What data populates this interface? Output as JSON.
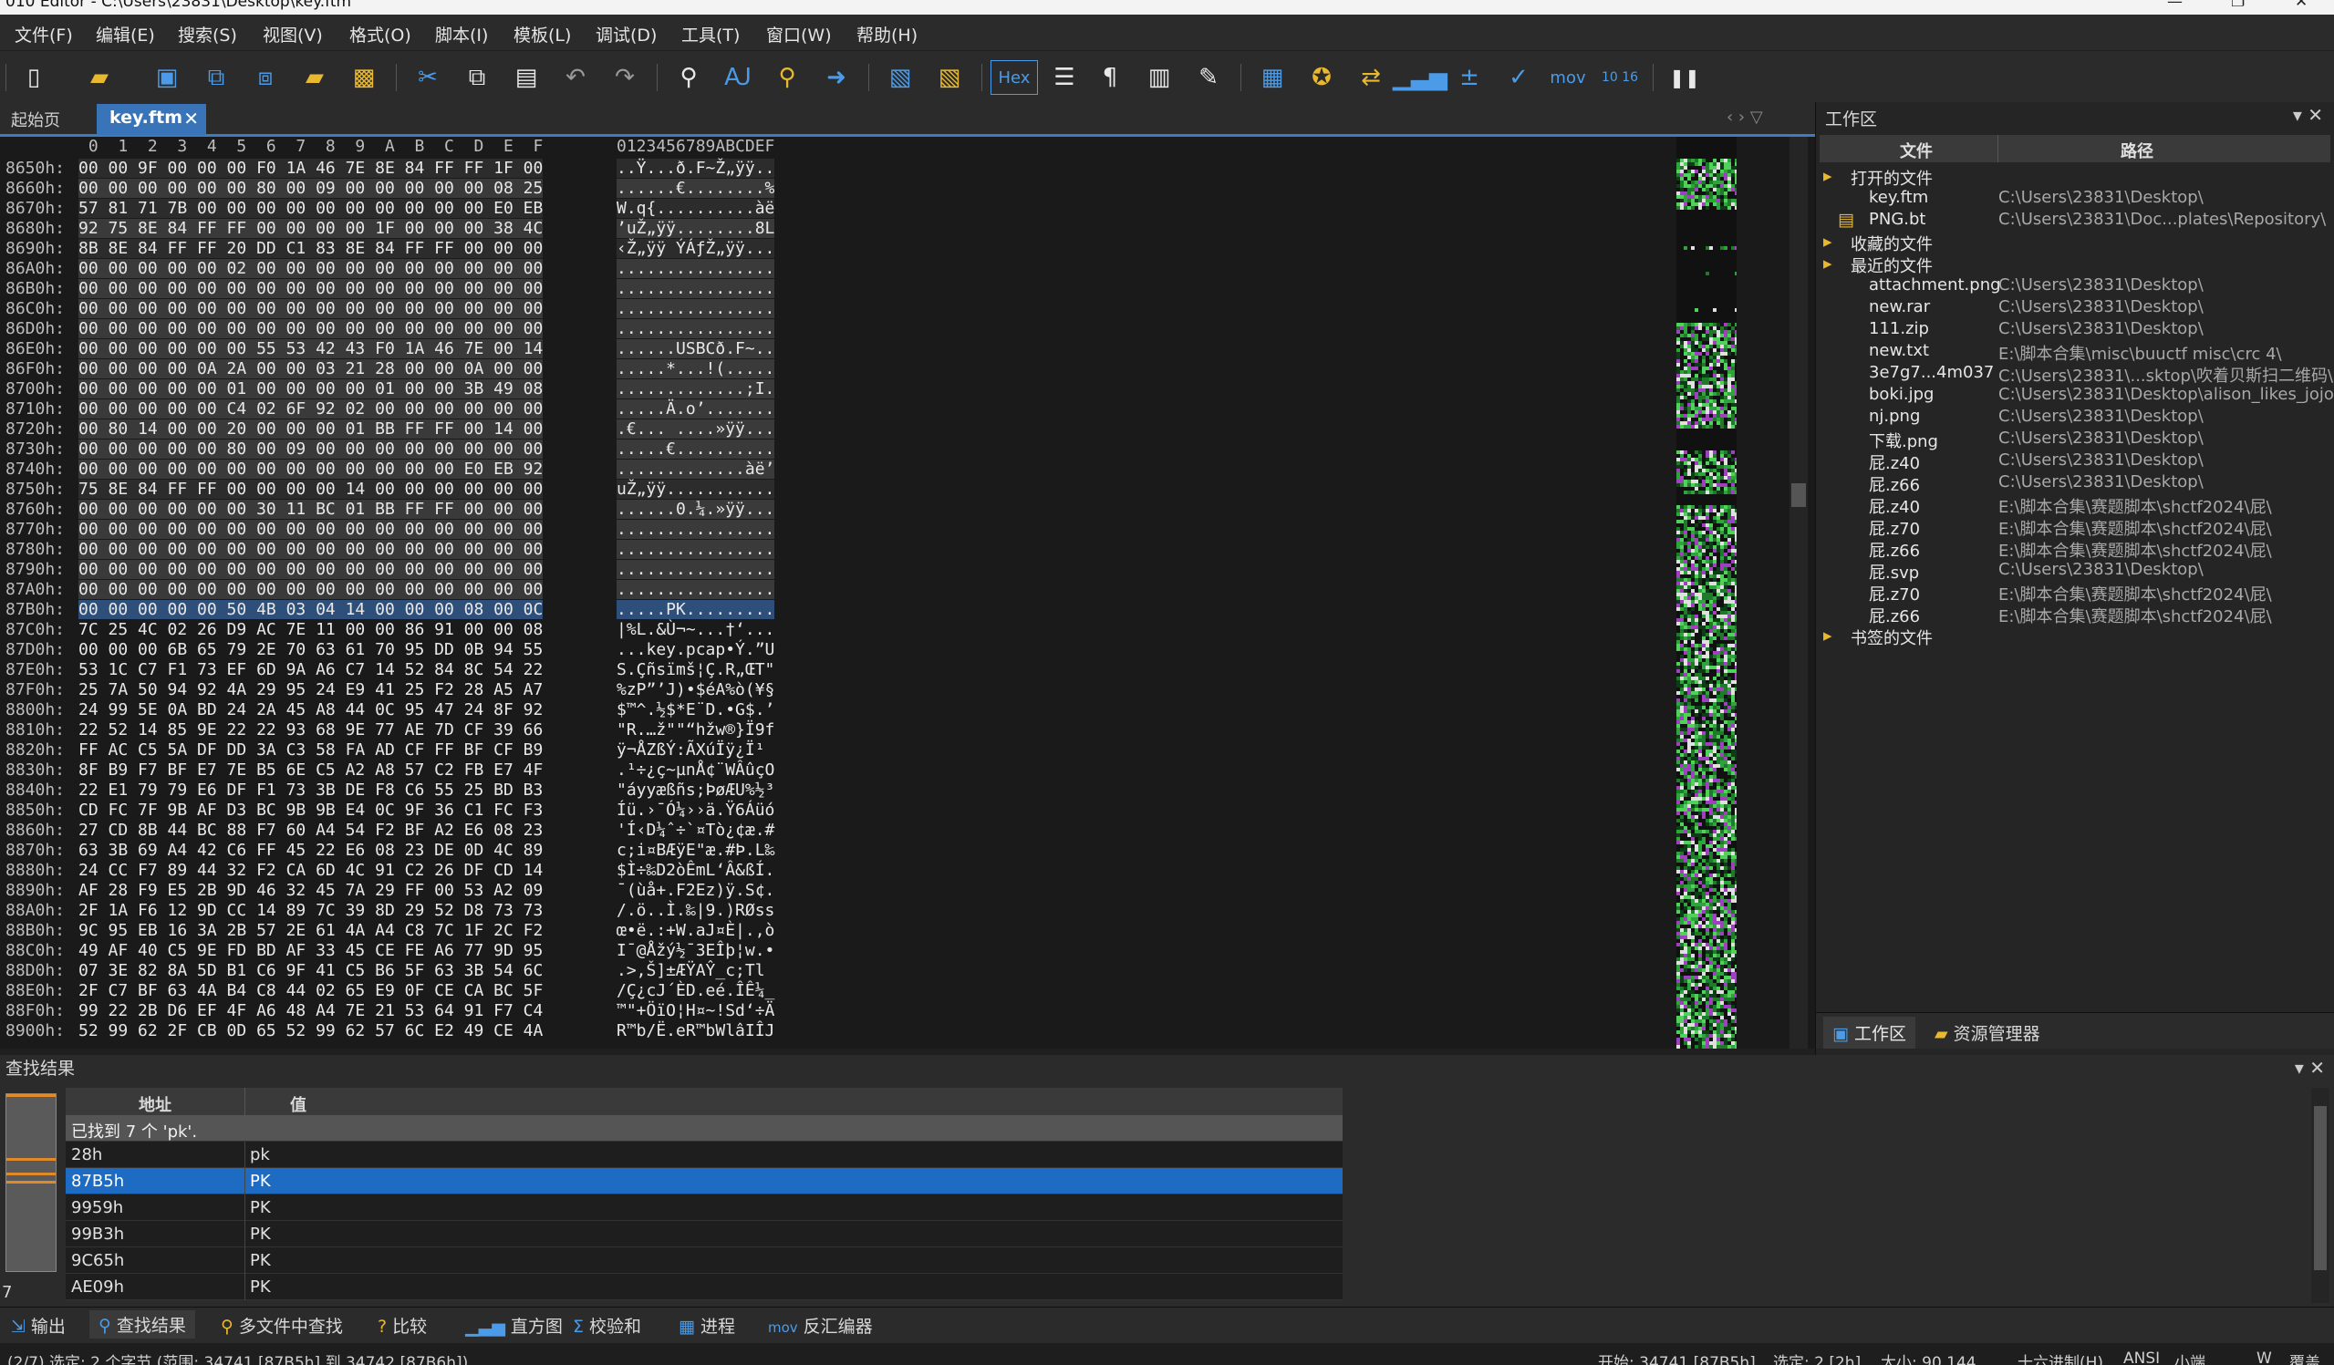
{
  "window": {
    "title": "010 Editor - C:\\Users\\23831\\Desktop\\key.ftm",
    "controls": [
      "—",
      "❐",
      "✕"
    ]
  },
  "menu": [
    "文件(F)",
    "编辑(E)",
    "搜索(S)",
    "视图(V)",
    "格式(O)",
    "脚本(I)",
    "模板(L)",
    "调试(D)",
    "工具(T)",
    "窗口(W)",
    "帮助(H)"
  ],
  "toolbar": {
    "hex_label": "Hex",
    "mov_label": "mov",
    "calc_label": "10 16"
  },
  "tabs": {
    "start": "起始页",
    "active": "key.ftm",
    "close": "✕",
    "nav": "‹  ›  ▽"
  },
  "hex": {
    "header_cols": " 0  1  2  3  4  5  6  7  8  9  A  B  C  D  E  F",
    "header_ascii": "0123456789ABCDEF",
    "rows": [
      {
        "addr": "8650h:",
        "bytes": "00 00 9F 00 00 00 F0 1A 46 7E 8E 84 FF FF 1F 00",
        "ascii": "..Ÿ...ð.F~Ž„ÿÿ..",
        "style": "alt"
      },
      {
        "addr": "8660h:",
        "bytes": "00 00 00 00 00 00 80 00 09 00 00 00 00 00 08 25",
        "ascii": "......€........%",
        "style": "zero"
      },
      {
        "addr": "8670h:",
        "bytes": "57 81 71 7B 00 00 00 00 00 00 00 00 00 00 E0 EB",
        "ascii": "W.q{..........àë",
        "style": "alt"
      },
      {
        "addr": "8680h:",
        "bytes": "92 75 8E 84 FF FF 00 00 00 00 1F 00 00 00 38 4C",
        "ascii": "’uŽ„ÿÿ........8L",
        "style": "zero"
      },
      {
        "addr": "8690h:",
        "bytes": "8B 8E 84 FF FF 20 DD C1 83 8E 84 FF FF 00 00 00",
        "ascii": "‹Ž„ÿÿ ÝÁƒŽ„ÿÿ...",
        "style": "alt"
      },
      {
        "addr": "86A0h:",
        "bytes": "00 00 00 00 00 02 00 00 00 00 00 00 00 00 00 00",
        "ascii": "................",
        "style": "zero"
      },
      {
        "addr": "86B0h:",
        "bytes": "00 00 00 00 00 00 00 00 00 00 00 00 00 00 00 00",
        "ascii": "................",
        "style": "zero"
      },
      {
        "addr": "86C0h:",
        "bytes": "00 00 00 00 00 00 00 00 00 00 00 00 00 00 00 00",
        "ascii": "................",
        "style": "zero"
      },
      {
        "addr": "86D0h:",
        "bytes": "00 00 00 00 00 00 00 00 00 00 00 00 00 00 00 00",
        "ascii": "................",
        "style": "zero"
      },
      {
        "addr": "86E0h:",
        "bytes": "00 00 00 00 00 00 55 53 42 43 F0 1A 46 7E 00 14",
        "ascii": "......USBCð.F~..",
        "style": "zero"
      },
      {
        "addr": "86F0h:",
        "bytes": "00 00 00 00 0A 2A 00 00 03 21 28 00 00 0A 00 00",
        "ascii": ".....*...!(.....",
        "style": "zero"
      },
      {
        "addr": "8700h:",
        "bytes": "00 00 00 00 00 01 00 00 00 00 01 00 00 3B 49 08",
        "ascii": ".............;I.",
        "style": "zero"
      },
      {
        "addr": "8710h:",
        "bytes": "00 00 00 00 00 C4 02 6F 92 02 00 00 00 00 00 00",
        "ascii": ".....Ä.o’.......",
        "style": "zero"
      },
      {
        "addr": "8720h:",
        "bytes": "00 80 14 00 00 20 00 00 00 01 BB FF FF 00 14 00",
        "ascii": ".€... ....»ÿÿ...",
        "style": "zero"
      },
      {
        "addr": "8730h:",
        "bytes": "00 00 00 00 00 80 00 09 00 00 00 00 00 00 00 00",
        "ascii": ".....€..........",
        "style": "zero"
      },
      {
        "addr": "8740h:",
        "bytes": "00 00 00 00 00 00 00 00 00 00 00 00 00 E0 EB 92",
        "ascii": ".............àë’",
        "style": "zero"
      },
      {
        "addr": "8750h:",
        "bytes": "75 8E 84 FF FF 00 00 00 00 14 00 00 00 00 00 00",
        "ascii": "uŽ„ÿÿ...........",
        "style": "alt"
      },
      {
        "addr": "8760h:",
        "bytes": "00 00 00 00 00 00 30 11 BC 01 BB FF FF 00 00 00",
        "ascii": "......0.¼.»ÿÿ...",
        "style": "zero"
      },
      {
        "addr": "8770h:",
        "bytes": "00 00 00 00 00 00 00 00 00 00 00 00 00 00 00 00",
        "ascii": "................",
        "style": "zero"
      },
      {
        "addr": "8780h:",
        "bytes": "00 00 00 00 00 00 00 00 00 00 00 00 00 00 00 00",
        "ascii": "................",
        "style": "zero"
      },
      {
        "addr": "8790h:",
        "bytes": "00 00 00 00 00 00 00 00 00 00 00 00 00 00 00 00",
        "ascii": "................",
        "style": "zero"
      },
      {
        "addr": "87A0h:",
        "bytes": "00 00 00 00 00 00 00 00 00 00 00 00 00 00 00 00",
        "ascii": "................",
        "style": "zero"
      },
      {
        "addr": "87B0h:",
        "bytes": "00 00 00 00 00 50 4B 03 04 14 00 00 00 08 00 0C",
        "ascii": ".....PK.........",
        "style": "sel"
      },
      {
        "addr": "87C0h:",
        "bytes": "7C 25 4C 02 26 D9 AC 7E 11 00 00 86 91 00 00 08",
        "ascii": "|%L.&Ù¬~...†‘...",
        "style": ""
      },
      {
        "addr": "87D0h:",
        "bytes": "00 00 00 6B 65 79 2E 70 63 61 70 95 DD 0B 94 55",
        "ascii": "...key.pcap•Ý.”U",
        "style": ""
      },
      {
        "addr": "87E0h:",
        "bytes": "53 1C C7 F1 73 EF 6D 9A A6 C7 14 52 84 8C 54 22",
        "ascii": "S.Çñsïmš¦Ç.R„ŒT\"",
        "style": ""
      },
      {
        "addr": "87F0h:",
        "bytes": "25 7A 50 94 92 4A 29 95 24 E9 41 25 F2 28 A5 A7",
        "ascii": "%zP”’J)•$éA%ò(¥§",
        "style": ""
      },
      {
        "addr": "8800h:",
        "bytes": "24 99 5E 0A BD 24 2A 45 A8 44 0C 95 47 24 8F 92",
        "ascii": "$™^.½$*E¨D.•G$.’",
        "style": ""
      },
      {
        "addr": "8810h:",
        "bytes": "22 52 14 85 9E 22 22 93 68 9E 77 AE 7D CF 39 66",
        "ascii": "\"R.…ž\"\"“hžw®}Ï9f",
        "style": ""
      },
      {
        "addr": "8820h:",
        "bytes": "FF AC C5 5A DF DD 3A C3 58 FA AD CF FF BF CF B9",
        "ascii": "ÿ¬ÅZßÝ:ÃXú­Ïÿ¿Ï¹",
        "style": ""
      },
      {
        "addr": "8830h:",
        "bytes": "8F B9 F7 BF E7 7E B5 6E C5 A2 A8 57 C2 FB E7 4F",
        "ascii": ".¹÷¿ç~µnÅ¢¨WÂûçO",
        "style": ""
      },
      {
        "addr": "8840h:",
        "bytes": "22 E1 79 79 E6 DF F1 73 3B DE F8 C6 55 25 BD B3",
        "ascii": "\"áyyæßñs;ÞøÆU%½³",
        "style": ""
      },
      {
        "addr": "8850h:",
        "bytes": "CD FC 7F 9B AF D3 BC 9B 9B E4 0C 9F 36 C1 FC F3",
        "ascii": "Íü.›¯Ó¼››ä.Ÿ6Áüó",
        "style": ""
      },
      {
        "addr": "8860h:",
        "bytes": "27 CD 8B 44 BC 88 F7 60 A4 54 F2 BF A2 E6 08 23",
        "ascii": "'Í‹D¼ˆ÷`¤Tò¿¢æ.#",
        "style": ""
      },
      {
        "addr": "8870h:",
        "bytes": "63 3B 69 A4 42 C6 FF 45 22 E6 08 23 DE 0D 4C 89",
        "ascii": "c;i¤BÆÿE\"æ.#Þ.L‰",
        "style": ""
      },
      {
        "addr": "8880h:",
        "bytes": "24 CC F7 89 44 32 F2 CA 6D 4C 91 C2 26 DF CD 14",
        "ascii": "$Ì÷‰D2òÊmL‘Â&ßÍ.",
        "style": ""
      },
      {
        "addr": "8890h:",
        "bytes": "AF 28 F9 E5 2B 9D 46 32 45 7A 29 FF 00 53 A2 09",
        "ascii": "¯(ùå+.F2Ez)ÿ.S¢.",
        "style": ""
      },
      {
        "addr": "88A0h:",
        "bytes": "2F 1A F6 12 9D CC 14 89 7C 39 8D 29 52 D8 73 73",
        "ascii": "/.ö..Ì.‰|9.)RØss",
        "style": ""
      },
      {
        "addr": "88B0h:",
        "bytes": "9C 95 EB 16 3A 2B 57 2E 61 4A A4 C8 7C 1F 2C F2",
        "ascii": "œ•ë.:+W.aJ¤È|.,ò",
        "style": ""
      },
      {
        "addr": "88C0h:",
        "bytes": "49 AF 40 C5 9E FD BD AF 33 45 CE FE A6 77 9D 95",
        "ascii": "I¯@Åžý½¯3EÎþ¦w.•",
        "style": ""
      },
      {
        "addr": "88D0h:",
        "bytes": "07 3E 82 8A 5D B1 C6 9F 41 C5 B6 5F 63 3B 54 6C",
        "ascii": ".>‚Š]±ÆŸAŶ_c;Tl",
        "style": ""
      },
      {
        "addr": "88E0h:",
        "bytes": "2F C7 BF 63 4A B4 C8 44 02 65 E9 0F CE CA BC 5F",
        "ascii": "/Ç¿cJ´ÈD.eé.ÎÊ¼_",
        "style": ""
      },
      {
        "addr": "88F0h:",
        "bytes": "99 22 2B D6 EF 4F A6 48 A4 7E 21 53 64 91 F7 C4",
        "ascii": "™\"+ÖïO¦H¤~!Sd‘÷Ä",
        "style": ""
      },
      {
        "addr": "8900h:",
        "bytes": "52 99 62 2F CB 0D 65 52 99 62 57 6C E2 49 CE 4A",
        "ascii": "R™b/Ë.eR™bWlâIÎJ",
        "style": ""
      }
    ]
  },
  "workspace": {
    "title": "工作区",
    "ctrl": "▾  ✕",
    "col_file": "文件",
    "col_path": "路径",
    "tree": [
      {
        "icon": "▸",
        "indent": 0,
        "name": "打开的文件",
        "path": ""
      },
      {
        "icon": "",
        "indent": 1,
        "name": "key.ftm",
        "path": "C:\\Users\\23831\\Desktop\\"
      },
      {
        "icon": "▤",
        "indent": 1,
        "name": "PNG.bt",
        "path": "C:\\Users\\23831\\Doc...plates\\Repository\\"
      },
      {
        "icon": "▸",
        "indent": 0,
        "name": "收藏的文件",
        "path": ""
      },
      {
        "icon": "▸",
        "indent": 0,
        "name": "最近的文件",
        "path": ""
      },
      {
        "icon": "",
        "indent": 1,
        "name": "attachment.png",
        "path": "C:\\Users\\23831\\Desktop\\"
      },
      {
        "icon": "",
        "indent": 1,
        "name": "new.rar",
        "path": "C:\\Users\\23831\\Desktop\\"
      },
      {
        "icon": "",
        "indent": 1,
        "name": "111.zip",
        "path": "C:\\Users\\23831\\Desktop\\"
      },
      {
        "icon": "",
        "indent": 1,
        "name": "new.txt",
        "path": "E:\\脚本合集\\misc\\buuctf misc\\crc 4\\"
      },
      {
        "icon": "",
        "indent": 1,
        "name": "3e7g7...4m037",
        "path": "C:\\Users\\23831\\...sktop\\吹着贝斯扫二维码\\"
      },
      {
        "icon": "",
        "indent": 1,
        "name": "boki.jpg",
        "path": "C:\\Users\\23831\\Desktop\\alison_likes_jojo\\"
      },
      {
        "icon": "",
        "indent": 1,
        "name": "nj.png",
        "path": "C:\\Users\\23831\\Desktop\\"
      },
      {
        "icon": "",
        "indent": 1,
        "name": "下载.png",
        "path": "C:\\Users\\23831\\Desktop\\"
      },
      {
        "icon": "",
        "indent": 1,
        "name": "屁.z40",
        "path": "C:\\Users\\23831\\Desktop\\"
      },
      {
        "icon": "",
        "indent": 1,
        "name": "屁.z66",
        "path": "C:\\Users\\23831\\Desktop\\"
      },
      {
        "icon": "",
        "indent": 1,
        "name": "屁.z40",
        "path": "E:\\脚本合集\\赛题脚本\\shctf2024\\屁\\"
      },
      {
        "icon": "",
        "indent": 1,
        "name": "屁.z70",
        "path": "E:\\脚本合集\\赛题脚本\\shctf2024\\屁\\"
      },
      {
        "icon": "",
        "indent": 1,
        "name": "屁.z66",
        "path": "E:\\脚本合集\\赛题脚本\\shctf2024\\屁\\"
      },
      {
        "icon": "",
        "indent": 1,
        "name": "屁.svp",
        "path": "C:\\Users\\23831\\Desktop\\"
      },
      {
        "icon": "",
        "indent": 1,
        "name": "屁.z70",
        "path": "E:\\脚本合集\\赛题脚本\\shctf2024\\屁\\"
      },
      {
        "icon": "",
        "indent": 1,
        "name": "屁.z66",
        "path": "E:\\脚本合集\\赛题脚本\\shctf2024\\屁\\"
      },
      {
        "icon": "▸",
        "indent": 0,
        "name": "书签的文件",
        "path": ""
      }
    ],
    "tab_workspace": "工作区",
    "tab_explorer": "资源管理器"
  },
  "find": {
    "title": "查找结果",
    "ctrl": "▾  ✕",
    "col_addr": "地址",
    "col_val": "值",
    "summary": "已找到 7 个 'pk'.",
    "rows": [
      {
        "addr": "28h",
        "val": "pk",
        "selected": false
      },
      {
        "addr": "87B5h",
        "val": "PK",
        "selected": true
      },
      {
        "addr": "9959h",
        "val": "PK",
        "selected": false
      },
      {
        "addr": "99B3h",
        "val": "PK",
        "selected": false
      },
      {
        "addr": "9C65h",
        "val": "PK",
        "selected": false
      },
      {
        "addr": "AE09h",
        "val": "PK",
        "selected": false
      }
    ],
    "side_number": "7"
  },
  "bottom_tabs": [
    "输出",
    "查找结果",
    "多文件中查找",
    "比较",
    "直方图",
    "校验和",
    "进程",
    "反汇编器"
  ],
  "status": {
    "left": "(2/7) 选定: 2 个字节 (范围: 34741 [87B5h] 到 34742 [87B6h])",
    "start": "开始: 34741 [87B5h]",
    "sel": "选定: 2 [2h]",
    "size": "大小: 90,144",
    "mode": "十六进制(H)",
    "enc": "ANSI",
    "endian": "小端",
    "w": "W",
    "ovr": "覆盖"
  },
  "colors": {
    "accent": "#3a74b8",
    "selection": "#1e6bc4",
    "folder": "#e8b830",
    "icon_blue": "#4b9be8"
  }
}
